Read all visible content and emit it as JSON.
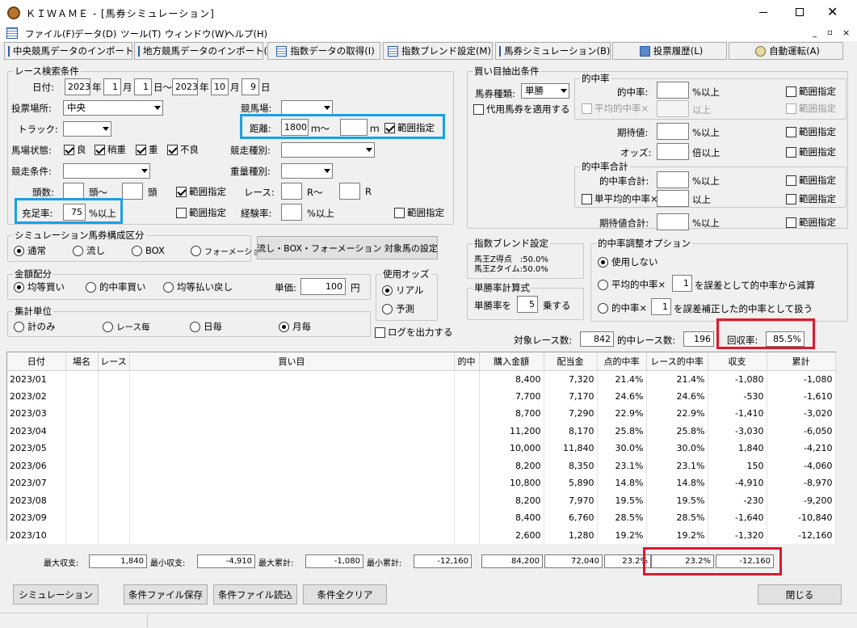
{
  "window": {
    "title": "ＫＩＷＡＭＥ - [馬券シミュレーション]"
  },
  "menu": [
    "ファイル(F)",
    "データ(D)",
    "ツール(T)",
    "ウィンドウ(W)",
    "ヘルプ(H)"
  ],
  "toolbar": [
    "中央競馬データのインポート(J)",
    "地方競馬データのインポート(N)",
    "指数データの取得(I)",
    "指数ブレンド設定(M)",
    "馬券シミュレーション(B)",
    "投票履歴(L)",
    "自動運転(A)"
  ],
  "race": {
    "legend": "レース検索条件",
    "date_label": "日付:",
    "y1": "2023",
    "y_u": "年",
    "m1": "1",
    "m_u": "月",
    "d1": "1",
    "d_u": "日～",
    "y2": "2023",
    "m2": "10",
    "d2": "9",
    "venue_label": "投票場所:",
    "venue": "中央",
    "track_label": "トラック:",
    "course_label": "競馬場:",
    "dist_label": "距離:",
    "dist_from": "1800",
    "dist_mid": "ｍ～",
    "dist_to": "",
    "dist_unit": "ｍ",
    "range_label": "範囲指定",
    "cond_label": "馬場状態:",
    "cond": [
      "良",
      "稍重",
      "重",
      "不良"
    ],
    "racetype_label": "競走種別:",
    "racecond_label": "競走条件:",
    "weight_label": "重量種別:",
    "heads_label": "頭数:",
    "heads_mid": "頭～",
    "heads_unit": "頭",
    "race_label": "レース:",
    "race_mid": "R～",
    "race_unit": "R",
    "fill_label": "充足率:",
    "fill": "75",
    "pct_above": "%以上",
    "exp_label": "経験率:"
  },
  "comp": {
    "legend": "シミュレーション馬券構成区分",
    "options": [
      "通常",
      "流し",
      "BOX",
      "フォーメーション"
    ],
    "button": "流し・BOX・フォーメーション 対象馬の設定"
  },
  "money": {
    "legend": "金額配分",
    "options": [
      "均等買い",
      "的中率買い",
      "均等払い戻し"
    ],
    "unit_label": "単価:",
    "unit": "100",
    "yen": "円"
  },
  "odds": {
    "legend": "使用オッズ",
    "options": [
      "リアル",
      "予測"
    ]
  },
  "agg": {
    "legend": "集計単位",
    "options": [
      "計のみ",
      "レース毎",
      "日毎",
      "月毎"
    ]
  },
  "log": "ログを出力する",
  "buy": {
    "legend": "買い目抽出条件",
    "type_label": "馬券種類:",
    "type": "単勝",
    "sub": "代用馬券を適用する",
    "hit_legend": "的中率",
    "hit": "的中率:",
    "avg_hit": "平均的中率×",
    "above": "以上",
    "pct_above": "%以上",
    "exp": "期待値:",
    "odds": "オッズ:",
    "odds_unit": "倍以上",
    "sum_legend": "的中率合計",
    "hit_sum": "的中率合計:",
    "single_avg": "単平均的中率×",
    "exp_sum": "期待値合計:"
  },
  "blend": {
    "legend": "指数ブレンド設定",
    "lines": [
      "馬王Z得点　:50.0%",
      "馬王Zタイム:50.0%"
    ]
  },
  "formula": {
    "legend": "単勝率計算式",
    "pre": "単勝率を",
    "val": "5",
    "post": "乗する"
  },
  "adj": {
    "legend": "的中率調整オプション",
    "opt1": "使用しない",
    "opt2a": "平均的中率×",
    "opt2b": "を誤差として的中率から減算",
    "opt3a": "的中率×",
    "opt3b": "を誤差補正した的中率として扱う",
    "v": "1"
  },
  "summary": {
    "races_label": "対象レース数:",
    "races": "842",
    "hits_label": "的中レース数:",
    "hits": "196",
    "recovery_label": "回収率:",
    "recovery": "85.5%"
  },
  "columns": [
    "日付",
    "場名",
    "レース",
    "買い目",
    "的中",
    "購入金額",
    "配当金",
    "点的中率",
    "レース的中率",
    "収支",
    "累計"
  ],
  "rows": [
    [
      "2023/01",
      "",
      "",
      "",
      "",
      "8,400",
      "7,320",
      "21.4%",
      "21.4%",
      "-1,080",
      "-1,080"
    ],
    [
      "2023/02",
      "",
      "",
      "",
      "",
      "7,700",
      "7,170",
      "24.6%",
      "24.6%",
      "-530",
      "-1,610"
    ],
    [
      "2023/03",
      "",
      "",
      "",
      "",
      "8,700",
      "7,290",
      "22.9%",
      "22.9%",
      "-1,410",
      "-3,020"
    ],
    [
      "2023/04",
      "",
      "",
      "",
      "",
      "11,200",
      "8,170",
      "25.8%",
      "25.8%",
      "-3,030",
      "-6,050"
    ],
    [
      "2023/05",
      "",
      "",
      "",
      "",
      "10,000",
      "11,840",
      "30.0%",
      "30.0%",
      "1,840",
      "-4,210"
    ],
    [
      "2023/06",
      "",
      "",
      "",
      "",
      "8,200",
      "8,350",
      "23.1%",
      "23.1%",
      "150",
      "-4,060"
    ],
    [
      "2023/07",
      "",
      "",
      "",
      "",
      "10,800",
      "5,890",
      "14.8%",
      "14.8%",
      "-4,910",
      "-8,970"
    ],
    [
      "2023/08",
      "",
      "",
      "",
      "",
      "8,200",
      "7,970",
      "19.5%",
      "19.5%",
      "-230",
      "-9,200"
    ],
    [
      "2023/09",
      "",
      "",
      "",
      "",
      "8,400",
      "6,760",
      "28.5%",
      "28.5%",
      "-1,640",
      "-10,840"
    ],
    [
      "2023/10",
      "",
      "",
      "",
      "",
      "2,600",
      "1,280",
      "19.2%",
      "19.2%",
      "-1,320",
      "-12,160"
    ]
  ],
  "totals": {
    "max_in_label": "最大収支:",
    "max_in": "1,840",
    "min_in_label": "最小収支:",
    "min_in": "-4,910",
    "max_cum_label": "最大累計:",
    "max_cum": "-1,080",
    "min_cum_label": "最小累計:",
    "min_cum": "-12,160",
    "buy": "84,200",
    "pay": "72,040",
    "hit": "23.2%",
    "race_hit": "23.2%",
    "balance": "-12,160"
  },
  "bottom": {
    "sim": "シミュレーション",
    "save": "条件ファイル保存",
    "load": "条件ファイル読込",
    "clear": "条件全クリア",
    "close": "閉じる"
  }
}
